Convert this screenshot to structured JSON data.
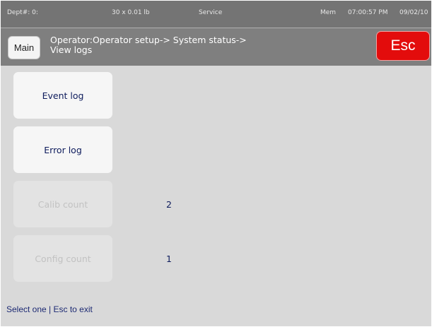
{
  "status_bar": {
    "dept": "Dept#: 0:",
    "capacity": "30 x 0.01 lb",
    "mode": "Service",
    "mem": "Mem",
    "time": "07:00:57 PM",
    "date": "09/02/10"
  },
  "header": {
    "main_label": "Main",
    "breadcrumb_line1": "Operator:Operator setup-> System status->",
    "breadcrumb_line2": "View logs",
    "esc_label": "Esc"
  },
  "items": [
    {
      "label": "Event log",
      "enabled": true,
      "count": ""
    },
    {
      "label": "Error log",
      "enabled": true,
      "count": ""
    },
    {
      "label": "Calib count",
      "enabled": false,
      "count": "2"
    },
    {
      "label": "Config count",
      "enabled": false,
      "count": "1"
    }
  ],
  "footer": {
    "hint": "Select one | Esc to exit"
  },
  "colors": {
    "status_bar_bg": "#747474",
    "header_bg": "#7f7f7f",
    "esc_button": "#e30c0c",
    "screen_bg": "#d9d9d9",
    "label_text": "#0d1b5c"
  }
}
